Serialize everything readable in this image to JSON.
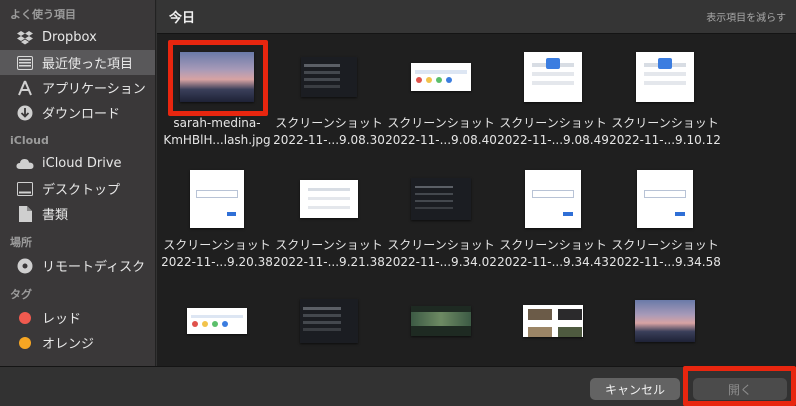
{
  "sidebar": {
    "favorites_title": "よく使う項目",
    "favorites": [
      {
        "label": "Dropbox",
        "icon": "dropbox-icon"
      },
      {
        "label": "最近使った項目",
        "icon": "recents-icon",
        "selected": true
      },
      {
        "label": "アプリケーション",
        "icon": "applications-icon"
      },
      {
        "label": "ダウンロード",
        "icon": "downloads-icon"
      }
    ],
    "icloud_title": "iCloud",
    "icloud": [
      {
        "label": "iCloud Drive",
        "icon": "cloud-icon"
      },
      {
        "label": "デスクトップ",
        "icon": "desktop-icon"
      },
      {
        "label": "書類",
        "icon": "document-icon"
      }
    ],
    "locations_title": "場所",
    "locations": [
      {
        "label": "リモートディスク",
        "icon": "disc-icon"
      }
    ],
    "tags_title": "タグ",
    "tags": [
      {
        "label": "レッド",
        "color": "#f05a4f"
      },
      {
        "label": "オレンジ",
        "color": "#f6a623"
      }
    ]
  },
  "main": {
    "section_title": "今日",
    "show_less": "表示項目を減らす",
    "files": [
      {
        "line1": "sarah-medina-",
        "line2": "KmHBlH...lash.jpg",
        "style": "sunset"
      },
      {
        "line1": "スクリーンショット",
        "line2": "2022-11-...9.08.30",
        "style": "dark-shot"
      },
      {
        "line1": "スクリーンショット",
        "line2": "2022-11-...9.08.40",
        "style": "wide-shot"
      },
      {
        "line1": "スクリーンショット",
        "line2": "2022-11-...9.08.49",
        "style": "light-shot"
      },
      {
        "line1": "スクリーンショット",
        "line2": "2022-11-...9.10.12",
        "style": "light-shot"
      },
      {
        "line1": "スクリーンショット",
        "line2": "2022-11-...9.20.38",
        "style": "form-shot"
      },
      {
        "line1": "スクリーンショット",
        "line2": "2022-11-...9.21.38",
        "style": "light-shot no-logo"
      },
      {
        "line1": "スクリーンショット",
        "line2": "2022-11-...9.34.02",
        "style": "dark-shot"
      },
      {
        "line1": "スクリーンショット",
        "line2": "2022-11-...9.34.43",
        "style": "form-shot"
      },
      {
        "line1": "スクリーンショット",
        "line2": "2022-11-...9.34.58",
        "style": "form-shot"
      },
      {
        "line1": "",
        "line2": "",
        "style": "wide-shot"
      },
      {
        "line1": "",
        "line2": "",
        "style": "dark-shot"
      },
      {
        "line1": "",
        "line2": "",
        "style": "greenbar"
      },
      {
        "line1": "",
        "line2": "",
        "style": "mosaic"
      },
      {
        "line1": "",
        "line2": "",
        "style": "sunset"
      }
    ]
  },
  "footer": {
    "cancel_label": "キャンセル",
    "open_label": "開く"
  }
}
